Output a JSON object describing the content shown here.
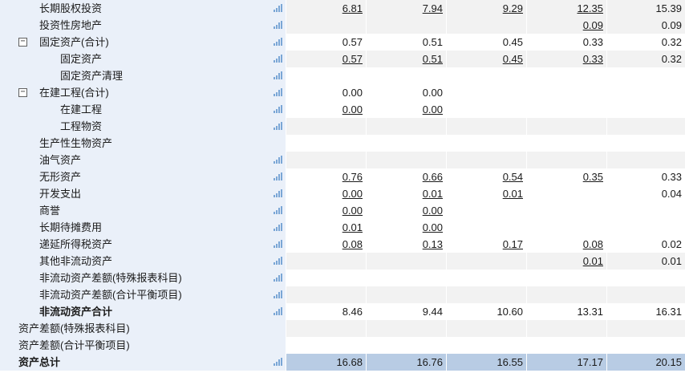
{
  "rows": [
    {
      "label": "长期股权投资",
      "level": 0,
      "expander": "",
      "icon": true,
      "bold": false,
      "alt": true,
      "total": false,
      "values": [
        "6.81",
        "7.94",
        "9.29",
        "12.35",
        "15.39"
      ],
      "links": [
        true,
        true,
        true,
        true,
        false
      ]
    },
    {
      "label": "投资性房地产",
      "level": 0,
      "expander": "",
      "icon": true,
      "bold": false,
      "alt": true,
      "total": false,
      "values": [
        "",
        "",
        "",
        "0.09",
        "0.09"
      ],
      "links": [
        false,
        false,
        false,
        true,
        false
      ]
    },
    {
      "label": "固定资产(合计)",
      "level": 0,
      "expander": "⊟",
      "icon": true,
      "bold": false,
      "alt": false,
      "total": false,
      "values": [
        "0.57",
        "0.51",
        "0.45",
        "0.33",
        "0.32"
      ],
      "links": [
        false,
        false,
        false,
        false,
        false
      ]
    },
    {
      "label": "固定资产",
      "level": 1,
      "expander": "",
      "icon": true,
      "bold": false,
      "alt": true,
      "total": false,
      "values": [
        "0.57",
        "0.51",
        "0.45",
        "0.33",
        "0.32"
      ],
      "links": [
        true,
        true,
        true,
        true,
        false
      ]
    },
    {
      "label": "固定资产清理",
      "level": 1,
      "expander": "",
      "icon": true,
      "bold": false,
      "alt": false,
      "total": false,
      "values": [
        "",
        "",
        "",
        "",
        ""
      ],
      "links": [
        false,
        false,
        false,
        false,
        false
      ]
    },
    {
      "label": "在建工程(合计)",
      "level": 0,
      "expander": "⊟",
      "icon": true,
      "bold": false,
      "alt": false,
      "total": false,
      "values": [
        "0.00",
        "0.00",
        "",
        "",
        ""
      ],
      "links": [
        false,
        false,
        false,
        false,
        false
      ]
    },
    {
      "label": "在建工程",
      "level": 1,
      "expander": "",
      "icon": true,
      "bold": false,
      "alt": false,
      "total": false,
      "values": [
        "0.00",
        "0.00",
        "",
        "",
        ""
      ],
      "links": [
        true,
        true,
        false,
        false,
        false
      ]
    },
    {
      "label": "工程物资",
      "level": 1,
      "expander": "",
      "icon": true,
      "bold": false,
      "alt": true,
      "total": false,
      "values": [
        "",
        "",
        "",
        "",
        ""
      ],
      "links": [
        false,
        false,
        false,
        false,
        false
      ]
    },
    {
      "label": "生产性生物资产",
      "level": 0,
      "expander": "",
      "icon": false,
      "bold": false,
      "alt": false,
      "total": false,
      "values": [
        "",
        "",
        "",
        "",
        ""
      ],
      "links": [
        false,
        false,
        false,
        false,
        false
      ]
    },
    {
      "label": "油气资产",
      "level": 0,
      "expander": "",
      "icon": true,
      "bold": false,
      "alt": true,
      "total": false,
      "values": [
        "",
        "",
        "",
        "",
        ""
      ],
      "links": [
        false,
        false,
        false,
        false,
        false
      ]
    },
    {
      "label": "无形资产",
      "level": 0,
      "expander": "",
      "icon": true,
      "bold": false,
      "alt": false,
      "total": false,
      "values": [
        "0.76",
        "0.66",
        "0.54",
        "0.35",
        "0.33"
      ],
      "links": [
        true,
        true,
        true,
        true,
        false
      ]
    },
    {
      "label": "开发支出",
      "level": 0,
      "expander": "",
      "icon": true,
      "bold": false,
      "alt": false,
      "total": false,
      "values": [
        "0.00",
        "0.01",
        "0.01",
        "",
        "0.04"
      ],
      "links": [
        true,
        true,
        true,
        false,
        false
      ]
    },
    {
      "label": "商誉",
      "level": 0,
      "expander": "",
      "icon": true,
      "bold": false,
      "alt": false,
      "total": false,
      "values": [
        "0.00",
        "0.00",
        "",
        "",
        ""
      ],
      "links": [
        true,
        true,
        false,
        false,
        false
      ]
    },
    {
      "label": "长期待摊费用",
      "level": 0,
      "expander": "",
      "icon": true,
      "bold": false,
      "alt": false,
      "total": false,
      "values": [
        "0.01",
        "0.00",
        "",
        "",
        ""
      ],
      "links": [
        true,
        true,
        false,
        false,
        false
      ]
    },
    {
      "label": "递延所得税资产",
      "level": 0,
      "expander": "",
      "icon": true,
      "bold": false,
      "alt": false,
      "total": false,
      "values": [
        "0.08",
        "0.13",
        "0.17",
        "0.08",
        "0.02"
      ],
      "links": [
        true,
        true,
        true,
        true,
        false
      ]
    },
    {
      "label": "其他非流动资产",
      "level": 0,
      "expander": "",
      "icon": true,
      "bold": false,
      "alt": true,
      "total": false,
      "values": [
        "",
        "",
        "",
        "0.01",
        "0.01"
      ],
      "links": [
        false,
        false,
        false,
        true,
        false
      ]
    },
    {
      "label": "非流动资产差额(特殊报表科目)",
      "level": 0,
      "expander": "",
      "icon": true,
      "bold": false,
      "alt": false,
      "total": false,
      "values": [
        "",
        "",
        "",
        "",
        ""
      ],
      "links": [
        false,
        false,
        false,
        false,
        false
      ]
    },
    {
      "label": "非流动资产差额(合计平衡项目)",
      "level": 0,
      "expander": "",
      "icon": true,
      "bold": false,
      "alt": true,
      "total": false,
      "values": [
        "",
        "",
        "",
        "",
        ""
      ],
      "links": [
        false,
        false,
        false,
        false,
        false
      ]
    },
    {
      "label": "非流动资产合计",
      "level": 0,
      "expander": "",
      "icon": true,
      "bold": true,
      "alt": false,
      "total": false,
      "values": [
        "8.46",
        "9.44",
        "10.60",
        "13.31",
        "16.31"
      ],
      "links": [
        false,
        false,
        false,
        false,
        false
      ]
    },
    {
      "label": "资产差额(特殊报表科目)",
      "level": -1,
      "expander": "",
      "icon": false,
      "bold": false,
      "alt": true,
      "total": false,
      "values": [
        "",
        "",
        "",
        "",
        ""
      ],
      "links": [
        false,
        false,
        false,
        false,
        false
      ]
    },
    {
      "label": "资产差额(合计平衡项目)",
      "level": -1,
      "expander": "",
      "icon": false,
      "bold": false,
      "alt": false,
      "total": false,
      "values": [
        "",
        "",
        "",
        "",
        ""
      ],
      "links": [
        false,
        false,
        false,
        false,
        false
      ]
    },
    {
      "label": "资产总计",
      "level": -1,
      "expander": "",
      "icon": true,
      "bold": true,
      "alt": false,
      "total": true,
      "values": [
        "16.68",
        "16.76",
        "16.55",
        "17.17",
        "20.15"
      ],
      "links": [
        false,
        false,
        false,
        false,
        false
      ]
    }
  ],
  "icons": {
    "chart": "bar-chart-icon",
    "expand": "collapse-toggle-icon"
  },
  "colors": {
    "label_bg": "#eaf0f9",
    "alt_row": "#f2f2f2",
    "total_row": "#b8cce4",
    "icon": "#7aa6d6"
  }
}
